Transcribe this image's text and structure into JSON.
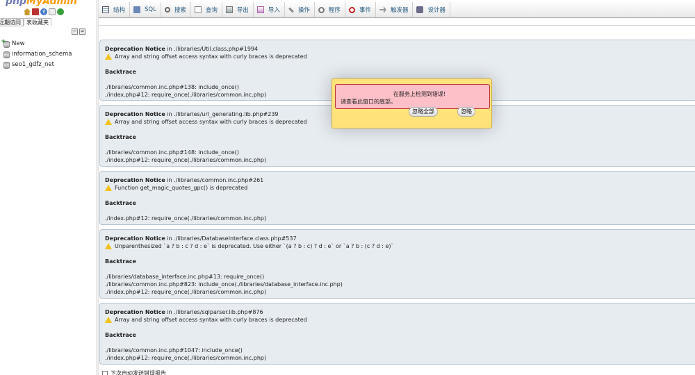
{
  "sidebar": {
    "logo_main": "php",
    "logo_accent": "MyAdmin",
    "tabs": [
      "近期访问",
      "表收藏夹"
    ],
    "tree": [
      {
        "label": "New"
      },
      {
        "label": "information_schema"
      },
      {
        "label": "seo1_gdfz_net"
      }
    ]
  },
  "topmenu": {
    "items": [
      {
        "label": "结构",
        "icon": "structure-icon"
      },
      {
        "label": "SQL",
        "icon": "sql-icon"
      },
      {
        "label": "搜索",
        "icon": "search-icon"
      },
      {
        "label": "查询",
        "icon": "query-icon"
      },
      {
        "label": "导出",
        "icon": "export-icon"
      },
      {
        "label": "导入",
        "icon": "import-icon"
      },
      {
        "label": "操作",
        "icon": "operations-icon"
      },
      {
        "label": "程序",
        "icon": "routines-icon"
      },
      {
        "label": "事件",
        "icon": "events-icon"
      },
      {
        "label": "触发器",
        "icon": "triggers-icon"
      },
      {
        "label": "设计器",
        "icon": "designer-icon"
      }
    ]
  },
  "notices": [
    {
      "type": "Deprecation Notice",
      "in": "in",
      "location": "./libraries/Util.class.php#1994",
      "message": "Array and string offset access syntax with curly braces is deprecated",
      "backtrace_title": "Backtrace",
      "backtrace": [
        "./libraries/common.inc.php#138: include_once()",
        "./index.php#12: require_once(./libraries/common.inc.php)"
      ]
    },
    {
      "type": "Deprecation Notice",
      "in": "in",
      "location": "./libraries/url_generating.lib.php#239",
      "message": "Array and string offset access syntax with curly braces is deprecated",
      "backtrace_title": "Backtrace",
      "backtrace": [
        "./libraries/common.inc.php#148: include_once()",
        "./index.php#12: require_once(./libraries/common.inc.php)"
      ]
    },
    {
      "type": "Deprecation Notice",
      "in": "in",
      "location": "./libraries/common.inc.php#261",
      "message": "Function get_magic_quotes_gpc() is deprecated",
      "backtrace_title": "Backtrace",
      "backtrace": [
        "./index.php#12: require_once(./libraries/common.inc.php)"
      ]
    },
    {
      "type": "Deprecation Notice",
      "in": "in",
      "location": "./libraries/DatabaseInterface.class.php#537",
      "message": "Unparenthesized `a ? b : c ? d : e` is deprecated. Use either `(a ? b : c) ? d : e` or `a ? b : (c ? d : e)`",
      "backtrace_title": "Backtrace",
      "backtrace": [
        "./libraries/database_interface.inc.php#13: require_once()",
        "./libraries/common.inc.php#823: include_once(./libraries/database_interface.inc.php)",
        "./index.php#12: require_once(./libraries/common.inc.php)"
      ]
    },
    {
      "type": "Deprecation Notice",
      "in": "in",
      "location": "./libraries/sqlparser.lib.php#876",
      "message": "Array and string offset access syntax with curly braces is deprecated",
      "backtrace_title": "Backtrace",
      "backtrace": [
        "./libraries/common.inc.php#1047: include_once()",
        "./index.php#12: require_once(./libraries/common.inc.php)"
      ]
    }
  ],
  "error_popup": {
    "title": "在服务上检测到错误!",
    "body": "请查看此窗口的底部。",
    "ignore_all_label": "忽略全部",
    "ignore_label": "忽略"
  },
  "footer": {
    "auto_report_label": "下次自动发送错误报告"
  },
  "colors": {
    "notice_bg": "#e7ecf1",
    "popup_bg": "#ffe27a",
    "error_bg": "#fdc0c8",
    "menu_text": "#235a81"
  }
}
